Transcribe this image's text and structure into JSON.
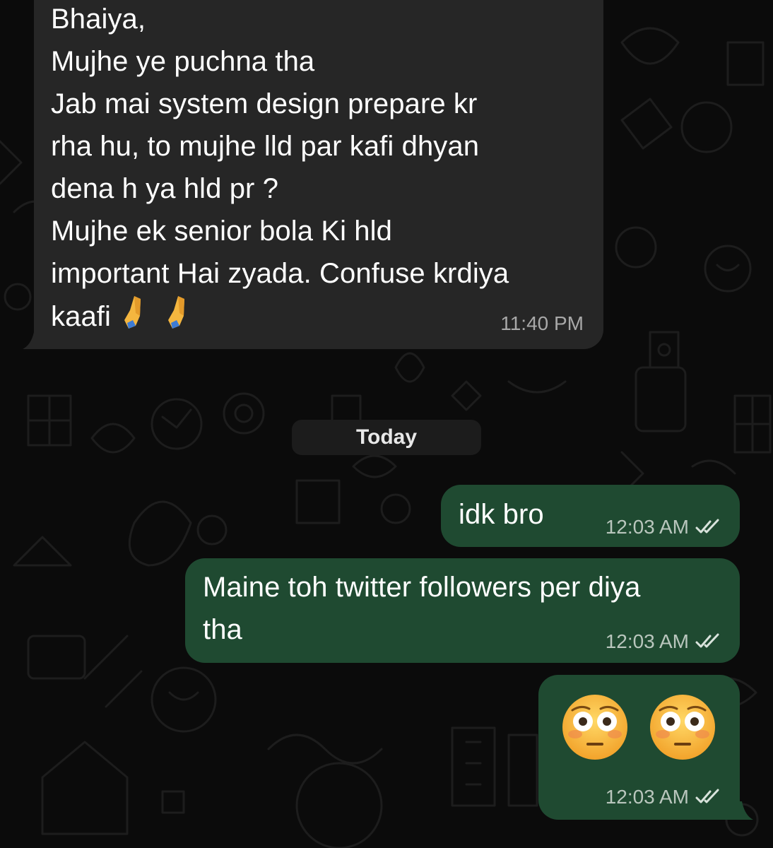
{
  "incoming_message": {
    "lines": [
      "Bhaiya,",
      "Mujhe ye puchna tha",
      "Jab mai system design prepare kr",
      "rha hu, to mujhe lld par kafi dhyan",
      "dena h ya hld pr ?",
      "Mujhe ek senior bola Ki hld",
      "important Hai zyada. Confuse krdiya",
      "kaafi"
    ],
    "emoji": "folded-hands-icon x2",
    "time": "11:40 PM"
  },
  "date_chip": "Today",
  "outgoing_messages": [
    {
      "text": "idk bro",
      "time": "12:03 AM",
      "status": "read-double-check"
    },
    {
      "lines": [
        "Maine toh twitter followers per diya",
        "tha"
      ],
      "time": "12:03 AM",
      "status": "read-double-check"
    },
    {
      "emoji": "flushed-face-icon x2",
      "time": "12:03 AM",
      "status": "read-double-check"
    }
  ],
  "colors": {
    "background": "#0b0b0b",
    "incoming_bubble": "#262626",
    "outgoing_bubble": "#1f4a31",
    "date_chip": "#1c1c1c",
    "timestamp_out": "#b9c6bd",
    "timestamp_in": "#a8a8a8"
  }
}
